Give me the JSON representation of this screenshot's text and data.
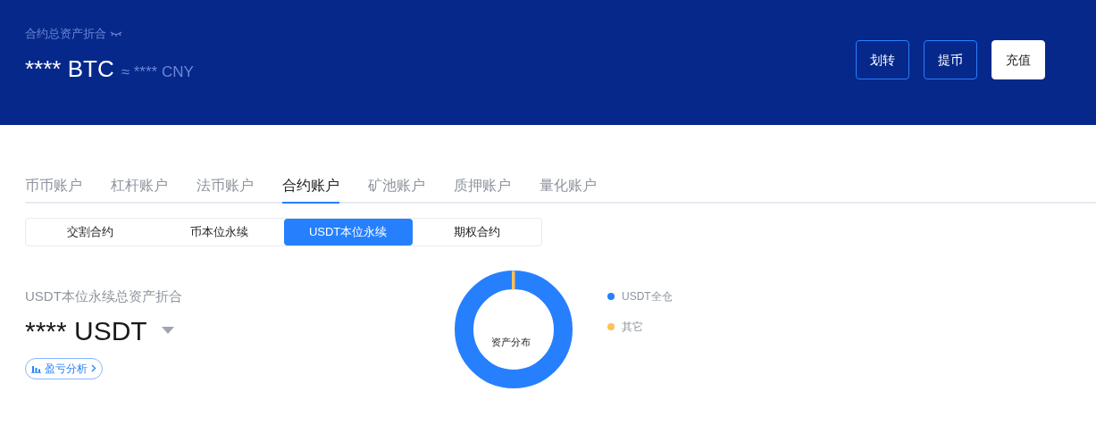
{
  "header": {
    "label": "合约总资产折合",
    "amount": "**** BTC",
    "approx": "≈ **** CNY",
    "buttons": [
      {
        "label": "划转",
        "kind": "outline"
      },
      {
        "label": "提币",
        "kind": "outline"
      },
      {
        "label": "充值",
        "kind": "solid"
      }
    ]
  },
  "tabs": [
    {
      "label": "币币账户",
      "selected": false
    },
    {
      "label": "杠杆账户",
      "selected": false
    },
    {
      "label": "法币账户",
      "selected": false
    },
    {
      "label": "合约账户",
      "selected": true
    },
    {
      "label": "矿池账户",
      "selected": false
    },
    {
      "label": "质押账户",
      "selected": false
    },
    {
      "label": "量化账户",
      "selected": false
    }
  ],
  "segments": [
    {
      "label": "交割合约",
      "selected": false
    },
    {
      "label": "币本位永续",
      "selected": false
    },
    {
      "label": "USDT本位永续",
      "selected": true
    },
    {
      "label": "期权合约",
      "selected": false
    }
  ],
  "summary": {
    "label": "USDT本位永续总资产折合",
    "amount": "**** USDT",
    "link": "盈亏分析"
  },
  "distribution": {
    "center": "资产分布",
    "legend": [
      {
        "label": "USDT全仓",
        "color": "#2680fe"
      },
      {
        "label": "其它",
        "color": "#fcc15a"
      }
    ]
  }
}
